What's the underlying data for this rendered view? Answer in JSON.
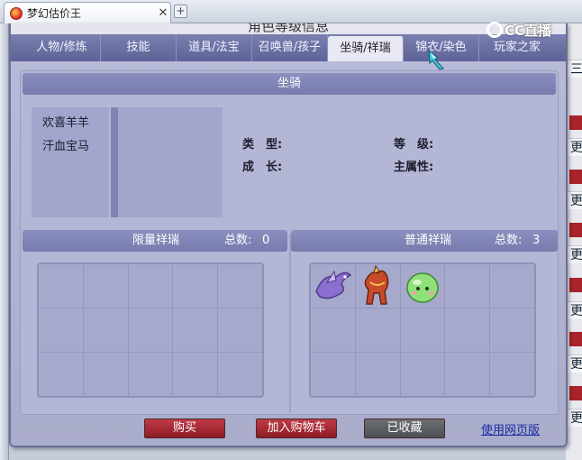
{
  "browser": {
    "tab_title": "梦幻估价王",
    "close_glyph": "✕",
    "new_tab_glyph": "+"
  },
  "dialog": {
    "title": "角色等级信息",
    "tabs": [
      "人物/修炼",
      "技能",
      "道具/法宝",
      "召唤兽/孩子",
      "坐骑/祥瑞",
      "锦衣/染色",
      "玩家之家"
    ],
    "active_tab": "坐骑/祥瑞"
  },
  "logo": {
    "text": "CC直播"
  },
  "mount_section": {
    "title": "坐骑",
    "items": [
      "欢喜羊羊",
      "汗血宝马"
    ],
    "attrs": {
      "type_label": "类　型:",
      "level_label": "等　级:",
      "growth_label": "成　长:",
      "main_attr_label": "主属性:"
    }
  },
  "limited_section": {
    "title": "限量祥瑞",
    "count_label": "总数:",
    "count": "0"
  },
  "normal_section": {
    "title": "普通祥瑞",
    "count_label": "总数:",
    "count": "3"
  },
  "buttons": {
    "buy": "购买",
    "add_cart": "加入购物车",
    "collected": "已收藏",
    "web_version": "使用网页版"
  },
  "right_edge": {
    "glyph": "更",
    "glyph_top": "三"
  },
  "colors": {
    "accent_red": "#a8232b",
    "tab_bar": "#6a6fa3",
    "panel": "#b4b6d6"
  }
}
